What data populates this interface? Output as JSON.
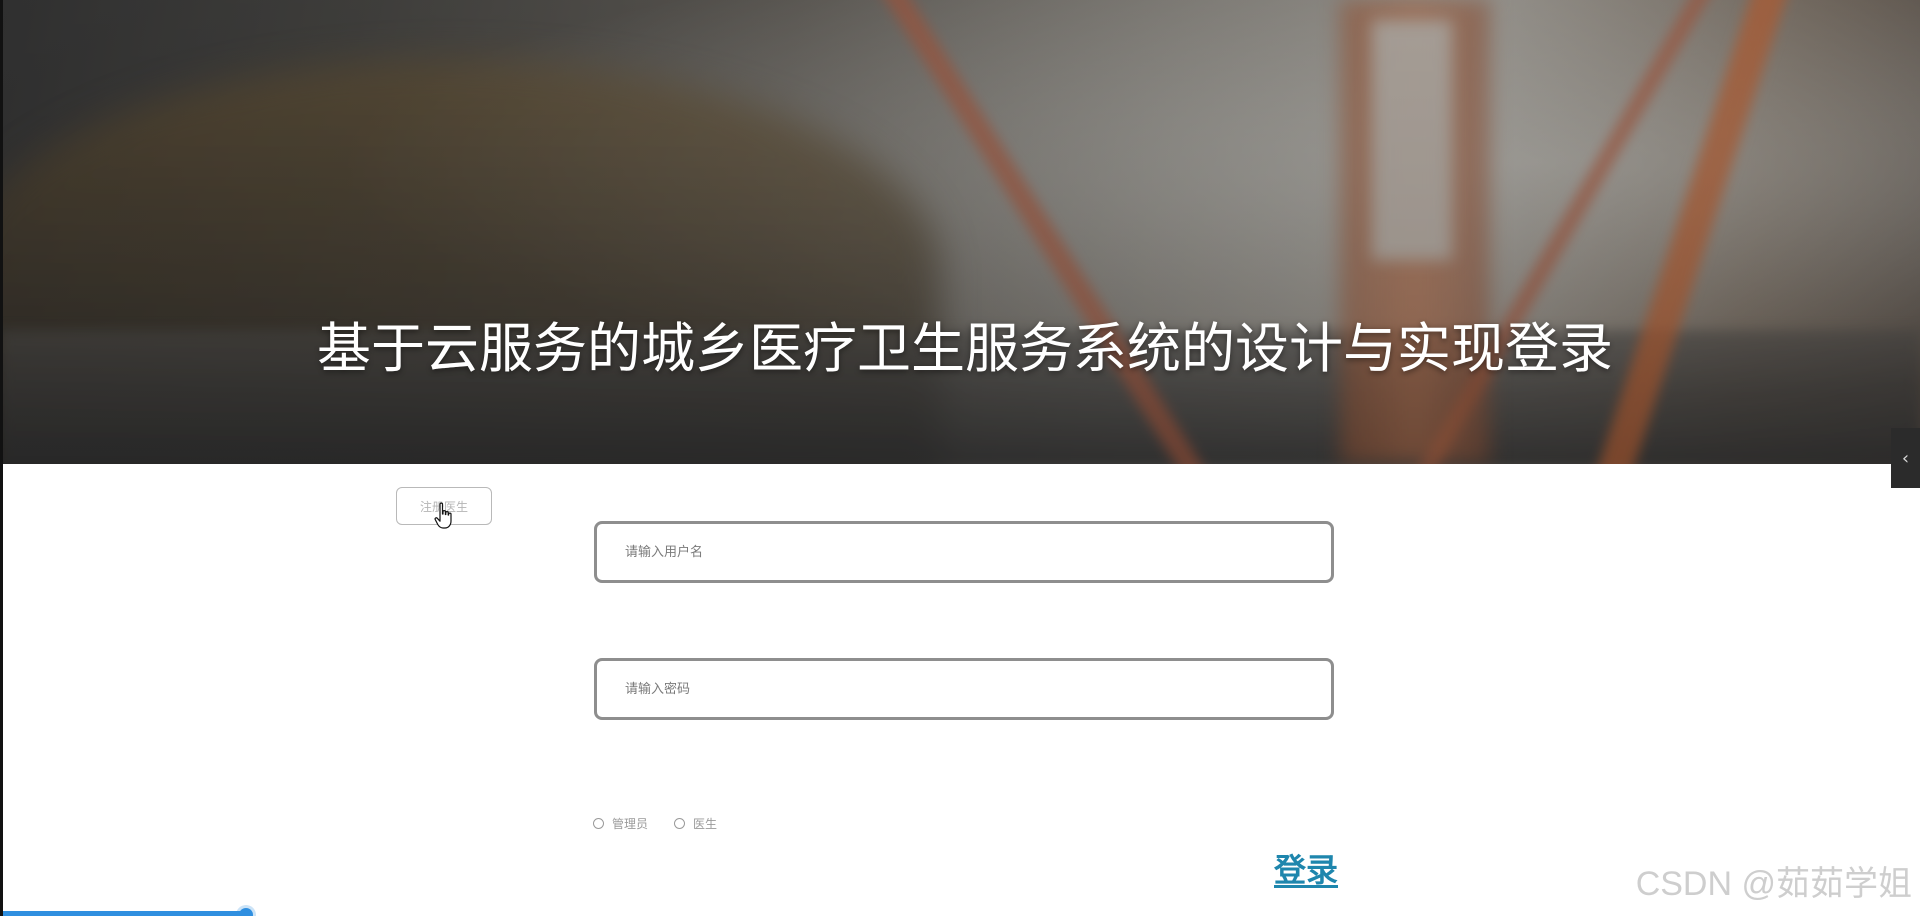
{
  "hero": {
    "title": "基于云服务的城乡医疗卫生服务系统的设计与实现登录"
  },
  "register": {
    "label": "注册医生"
  },
  "login_form": {
    "username_placeholder": "请输入用户名",
    "password_placeholder": "请输入密码",
    "roles": [
      {
        "label": "管理员",
        "selected": false
      },
      {
        "label": "医生",
        "selected": false
      }
    ],
    "submit_label": "登录"
  },
  "side_toggle": {
    "icon": "chevron-left-icon",
    "glyph": "‹"
  },
  "watermark": {
    "text": "CSDN @茹茹学姐"
  },
  "video_progress": {
    "fraction": 0.128,
    "color": "#2f8fe0"
  },
  "colors": {
    "login_link": "#1e86ad",
    "field_border": "#8e8e8e"
  }
}
